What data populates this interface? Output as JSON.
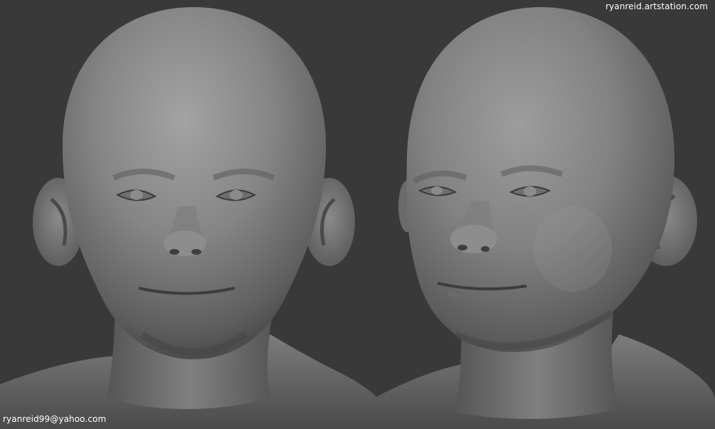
{
  "image": {
    "subject": "two sculpted bald child head busts",
    "views": [
      "front",
      "three-quarter"
    ],
    "colors": {
      "background": "#393939",
      "sculpt_light": "#9a9a9a",
      "sculpt_mid": "#6f6f6f",
      "sculpt_dark": "#2c2c2c",
      "watermark_text": "#ffffff"
    }
  },
  "watermarks": {
    "site": "ryanreid.artstation.com",
    "email": "ryanreid99@yahoo.com"
  }
}
